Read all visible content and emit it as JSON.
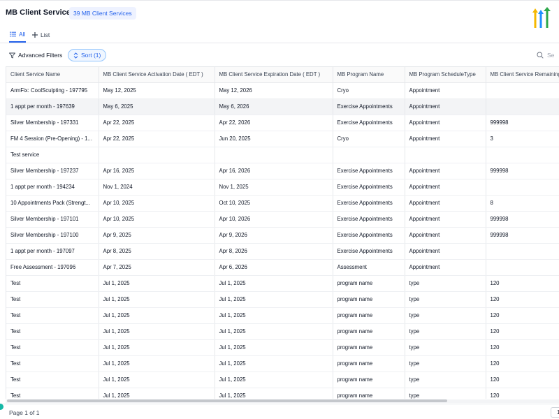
{
  "header": {
    "title": "MB Client Services",
    "count_badge": "39 MB Client Services"
  },
  "tabs": [
    {
      "label": "All",
      "icon": "list-icon",
      "active": true
    },
    {
      "label": "List",
      "icon": "plus-icon",
      "active": false
    }
  ],
  "toolbar": {
    "filters_label": "Advanced Filters",
    "sort_label": "Sort (1)",
    "search_placeholder": "Se"
  },
  "table": {
    "columns": [
      "Client Service Name",
      "MB Client Service Activation Date ( EDT )",
      "MB Client Service Expiration Date ( EDT )",
      "MB Program Name",
      "MB Program ScheduleType",
      "MB Client Service Remaining"
    ],
    "rows": [
      [
        "ArmFix: CoolSculpting - 197795",
        "May 12, 2025",
        "May 12, 2026",
        "Cryo",
        "Appointment",
        ""
      ],
      [
        "1 appt per month - 197639",
        "May 6, 2025",
        "May 6, 2026",
        "Exercise Appointments",
        "Appointment",
        ""
      ],
      [
        "Silver Membership - 197331",
        "Apr 22, 2025",
        "Apr 22, 2026",
        "Exercise Appointments",
        "Appointment",
        "999998"
      ],
      [
        "FM 4 Session (Pre-Opening) - 1...",
        "Apr 22, 2025",
        "Jun 20, 2025",
        "Cryo",
        "Appointment",
        "3"
      ],
      [
        "Test service",
        "",
        "",
        "",
        "",
        ""
      ],
      [
        "Silver Membership - 197237",
        "Apr 16, 2025",
        "Apr 16, 2026",
        "Exercise Appointments",
        "Appointment",
        "999998"
      ],
      [
        "1 appt per month - 194234",
        "Nov 1, 2024",
        "Nov 1, 2025",
        "Exercise Appointments",
        "Appointment",
        ""
      ],
      [
        "10 Appointments Pack (Strengt...",
        "Apr 10, 2025",
        "Oct 10, 2025",
        "Exercise Appointments",
        "Appointment",
        "8"
      ],
      [
        "Silver Membership - 197101",
        "Apr 10, 2025",
        "Apr 10, 2026",
        "Exercise Appointments",
        "Appointment",
        "999998"
      ],
      [
        "Silver Membership - 197100",
        "Apr 9, 2025",
        "Apr 9, 2026",
        "Exercise Appointments",
        "Appointment",
        "999998"
      ],
      [
        "1 appt per month - 197097",
        "Apr 8, 2025",
        "Apr 8, 2026",
        "Exercise Appointments",
        "Appointment",
        ""
      ],
      [
        "Free Assessment - 197096",
        "Apr 7, 2025",
        "Apr 6, 2026",
        "Assessment",
        "Appointment",
        ""
      ],
      [
        "Test",
        "Jul 1, 2025",
        "Jul 1, 2025",
        "program name",
        "type",
        "120"
      ],
      [
        "Test",
        "Jul 1, 2025",
        "Jul 1, 2025",
        "program name",
        "type",
        "120"
      ],
      [
        "Test",
        "Jul 1, 2025",
        "Jul 1, 2025",
        "program name",
        "type",
        "120"
      ],
      [
        "Test",
        "Jul 1, 2025",
        "Jul 1, 2025",
        "program name",
        "type",
        "120"
      ],
      [
        "Test",
        "Jul 1, 2025",
        "Jul 1, 2025",
        "program name",
        "type",
        "120"
      ],
      [
        "Test",
        "Jul 1, 2025",
        "Jul 1, 2025",
        "program name",
        "type",
        "120"
      ],
      [
        "Test",
        "Jul 1, 2025",
        "Jul 1, 2025",
        "program name",
        "type",
        "120"
      ],
      [
        "Test",
        "Jul 1, 2025",
        "Jul 1, 2025",
        "program name",
        "type",
        "120"
      ]
    ],
    "highlighted_row": 1
  },
  "footer": {
    "page_info": "Page 1 of 1",
    "page_number": "1"
  },
  "colors": {
    "accent": "#2563eb",
    "logo_yellow": "#f5b800",
    "logo_blue": "#1e90ff",
    "logo_green": "#2ea84a"
  }
}
